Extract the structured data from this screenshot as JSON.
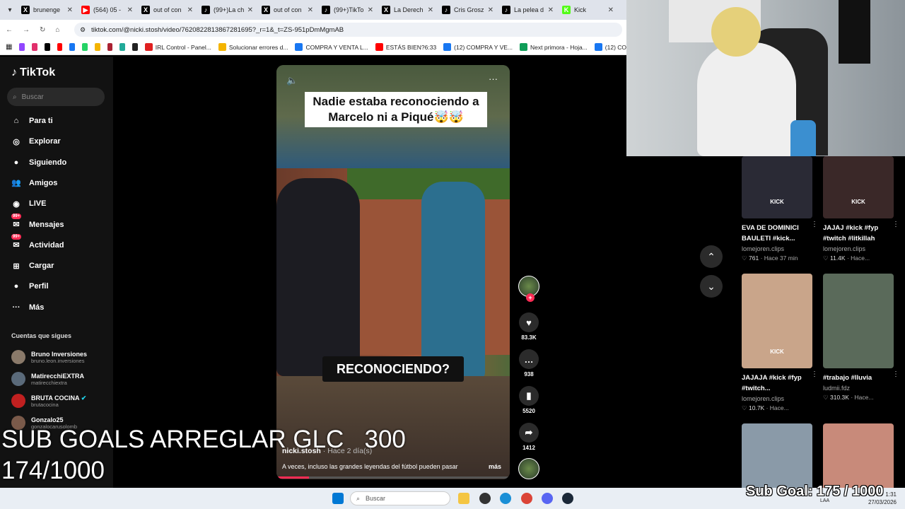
{
  "browser": {
    "tabs": [
      {
        "label": "brunenge",
        "color": "#000000",
        "glyph": "X"
      },
      {
        "label": "(564) 05 -",
        "color": "#ff0000",
        "glyph": "▶"
      },
      {
        "label": "out of con",
        "color": "#000000",
        "glyph": "X"
      },
      {
        "label": "(99+)La ch",
        "color": "#000000",
        "glyph": "♪"
      },
      {
        "label": "out of con",
        "color": "#000000",
        "glyph": "X"
      },
      {
        "label": "(99+)TikTo",
        "color": "#000000",
        "glyph": "♪"
      },
      {
        "label": "La Derech",
        "color": "#000000",
        "glyph": "X"
      },
      {
        "label": "Cris Grosz",
        "color": "#000000",
        "glyph": "♪"
      },
      {
        "label": "La pelea d",
        "color": "#000000",
        "glyph": "♪"
      },
      {
        "label": "Kick",
        "color": "#53fc18",
        "glyph": "K"
      }
    ],
    "url": "tiktok.com/@nicki.stosh/video/7620822813867281695?_r=1&_t=ZS-951pDmMgmAB",
    "bookmarks": [
      {
        "label": "IRL Control - Panel...",
        "color": "#e02020"
      },
      {
        "label": "Solucionar errores d...",
        "color": "#f4b400"
      },
      {
        "label": "COMPRA Y VENTA L...",
        "color": "#1877f2"
      },
      {
        "label": "ESTÁS BIEN?6:33",
        "color": "#ff0000"
      },
      {
        "label": "(12) COMPRA Y VE...",
        "color": "#1877f2"
      },
      {
        "label": "Next primora - Hoja...",
        "color": "#0f9d58"
      },
      {
        "label": "(12) CO",
        "color": "#1877f2"
      }
    ]
  },
  "tiktok": {
    "logo": "TikTok",
    "search_placeholder": "Buscar",
    "nav": [
      {
        "label": "Para ti",
        "icon": "home-icon"
      },
      {
        "label": "Explorar",
        "icon": "compass-icon"
      },
      {
        "label": "Siguiendo",
        "icon": "following-icon"
      },
      {
        "label": "Amigos",
        "icon": "friends-icon"
      },
      {
        "label": "LIVE",
        "icon": "live-icon"
      },
      {
        "label": "Mensajes",
        "icon": "message-icon",
        "badge": "99+"
      },
      {
        "label": "Actividad",
        "icon": "activity-icon",
        "badge": "99+"
      },
      {
        "label": "Cargar",
        "icon": "upload-icon"
      },
      {
        "label": "Perfil",
        "icon": "profile-icon"
      },
      {
        "label": "Más",
        "icon": "more-icon"
      }
    ],
    "following_heading": "Cuentas que sigues",
    "following": [
      {
        "name": "Bruno Inversiones",
        "handle": "bruno.leon.inversiones",
        "color": "#8a7a6a"
      },
      {
        "name": "MatirecchiEXTRA",
        "handle": "matirecchiextra",
        "color": "#5a6a7a"
      },
      {
        "name": "BRUTA COCINA",
        "handle": "brutacocina",
        "color": "#c02020",
        "verified": "✔"
      },
      {
        "name": "Gonzalo25",
        "handle": "gonzalocarusolomb",
        "color": "#7a5a4a"
      }
    ]
  },
  "video": {
    "caption": "Nadie estaba reconociendo a Marcelo ni a Piqué🤯🤯",
    "overlay": "RECONOCIENDO?",
    "username": "nicki.stosh",
    "time": "· Hace 2 día(s)",
    "description": "A veces, incluso las grandes leyendas del fútbol pueden pasar",
    "more": "más",
    "progress": 0.14,
    "likes": "83.3K",
    "comments": "938",
    "saves": "5520",
    "shares": "1412"
  },
  "grid": [
    {
      "title": "EVA DE DOMINICI BAULETI #kick...",
      "user": "lomejoren.clips",
      "likes": "761",
      "time": "· Hace 37 min",
      "thumb": "#2a2a35",
      "label": "KICK"
    },
    {
      "title": "JAJAJ #kick #fyp #twitch #litkillah",
      "user": "lomejoren.clips",
      "likes": "11.4K",
      "time": "· Hace...",
      "thumb": "#3a2828",
      "label": "KICK"
    },
    {
      "title": "JAJAJA #kick #fyp #twitch...",
      "user": "lomejoren.clips",
      "likes": "10.7K",
      "time": "· Hace...",
      "thumb": "#c9a58a",
      "label": "KICK"
    },
    {
      "title": "#trabajo #lluvia",
      "user": "ludmii.fdz",
      "likes": "310.3K",
      "time": "· Hace...",
      "thumb": "#5a6a5a",
      "label": ""
    },
    {
      "title": "",
      "user": "",
      "likes": "",
      "time": "",
      "thumb": "#8a9aa8",
      "label": ""
    },
    {
      "title": "",
      "user": "",
      "likes": "",
      "time": "",
      "thumb": "#c88a7a",
      "label": ""
    }
  ],
  "overlay": {
    "subgoals_line1": "SUB GOALS ARREGLAR GLC   300",
    "subgoals_line2": "174/1000",
    "subgoal_right": "Sub Goal: 175 / 1000"
  },
  "taskbar": {
    "search": "Buscar",
    "lang": "LAA",
    "time": "1:31",
    "date": "27/03/2026"
  }
}
